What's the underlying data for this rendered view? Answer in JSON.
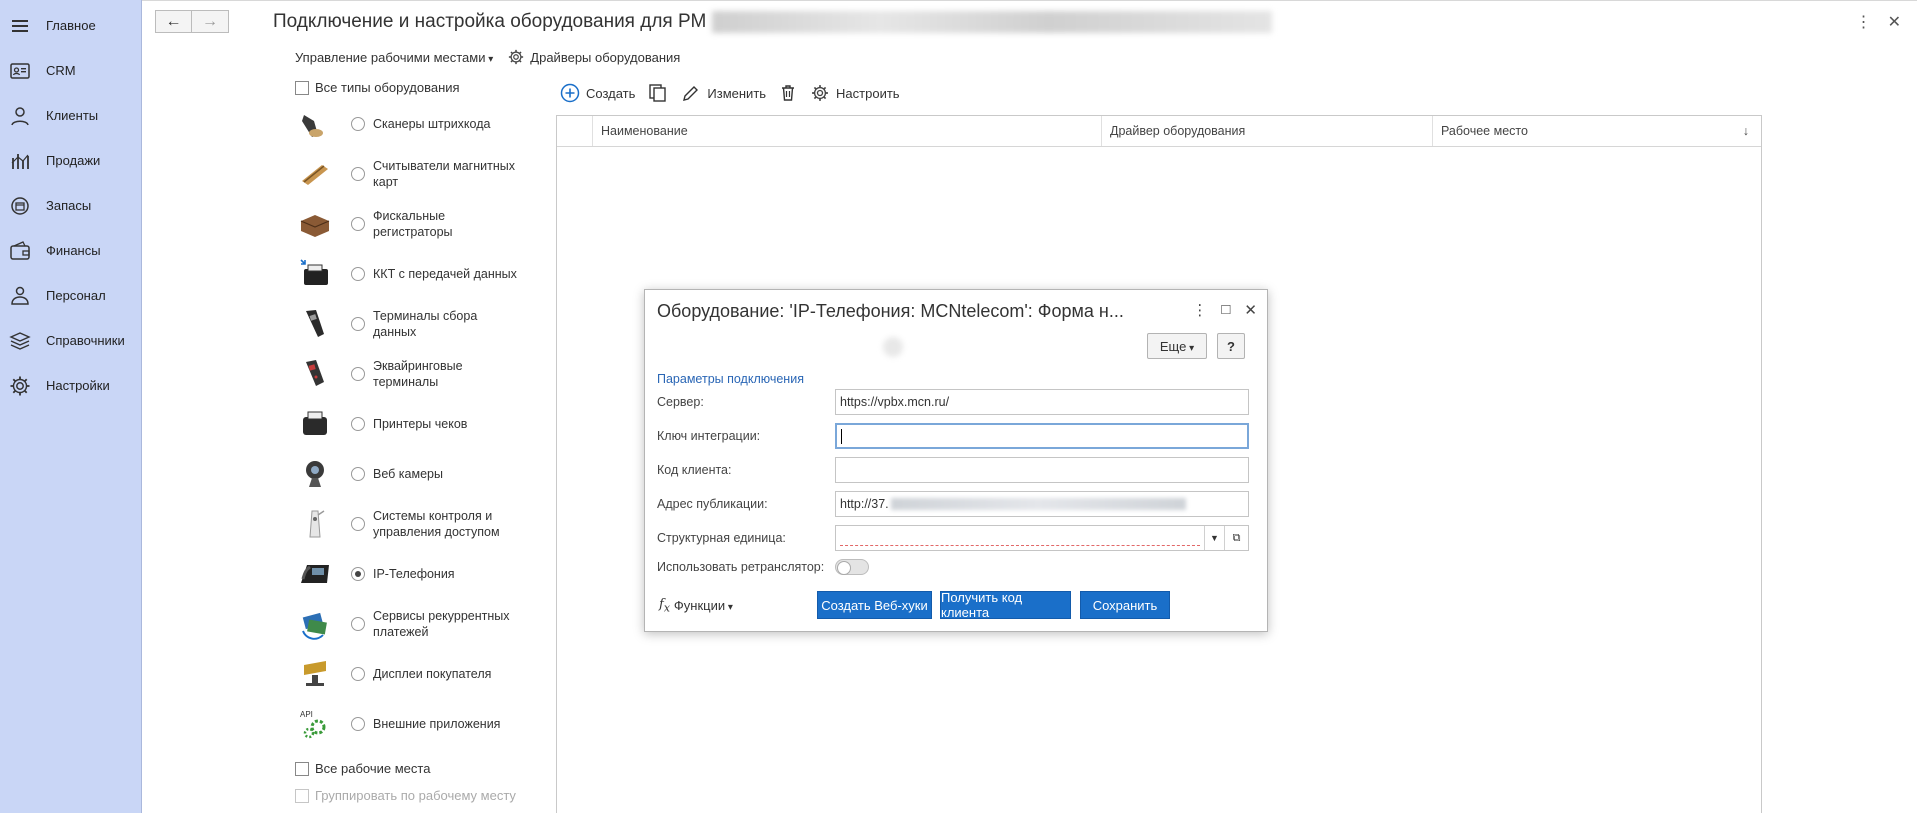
{
  "sidebar": {
    "items": [
      {
        "label": "Главное",
        "icon": "menu-icon"
      },
      {
        "label": "CRM",
        "icon": "contact-card-icon"
      },
      {
        "label": "Клиенты",
        "icon": "person-icon"
      },
      {
        "label": "Продажи",
        "icon": "sales-chart-icon"
      },
      {
        "label": "Запасы",
        "icon": "stock-box-icon"
      },
      {
        "label": "Финансы",
        "icon": "wallet-icon"
      },
      {
        "label": "Персонал",
        "icon": "staff-icon"
      },
      {
        "label": "Справочники",
        "icon": "layers-icon"
      },
      {
        "label": "Настройки",
        "icon": "gear-icon"
      }
    ]
  },
  "header": {
    "title": "Подключение и настройка оборудования для РМ"
  },
  "toolbar": {
    "workplaces_label": "Управление рабочими местами",
    "drivers_label": "Драйверы оборудования"
  },
  "equipment": {
    "all_types_label": "Все типы оборудования",
    "types": [
      {
        "label": "Сканеры штрихкода",
        "icon": "barcode-scanner-icon",
        "selected": false
      },
      {
        "label": "Считыватели магнитных карт",
        "icon": "card-reader-icon",
        "selected": false
      },
      {
        "label": "Фискальные регистраторы",
        "icon": "fiscal-register-icon",
        "selected": false
      },
      {
        "label": "ККТ с передачей данных",
        "icon": "kkt-online-icon",
        "selected": false
      },
      {
        "label": "Терминалы сбора данных",
        "icon": "data-terminal-icon",
        "selected": false
      },
      {
        "label": "Эквайринговые терминалы",
        "icon": "acquiring-terminal-icon",
        "selected": false
      },
      {
        "label": "Принтеры чеков",
        "icon": "receipt-printer-icon",
        "selected": false
      },
      {
        "label": "Веб камеры",
        "icon": "webcam-icon",
        "selected": false
      },
      {
        "label": "Системы контроля и управления доступом",
        "icon": "access-control-icon",
        "selected": false
      },
      {
        "label": "IP-Телефония",
        "icon": "ip-phone-icon",
        "selected": true
      },
      {
        "label": "Сервисы рекуррентных платежей",
        "icon": "recurring-payments-icon",
        "selected": false
      },
      {
        "label": "Дисплеи покупателя",
        "icon": "customer-display-icon",
        "selected": false
      },
      {
        "label": "Внешние приложения",
        "icon": "api-gear-icon",
        "selected": false
      }
    ],
    "all_workplaces_label": "Все рабочие места",
    "group_by_workplace_label": "Группировать по рабочему месту"
  },
  "list_toolbar": {
    "create_label": "Создать",
    "edit_label": "Изменить",
    "configure_label": "Настроить"
  },
  "table": {
    "columns": [
      "Наименование",
      "Драйвер оборудования",
      "Рабочее место"
    ],
    "sort_indicator": "↓",
    "rows": []
  },
  "dialog": {
    "title": "Оборудование: 'IP-Телефония: MCNtelecom': Форма н...",
    "more_label": "Еще",
    "help_label": "?",
    "section_label": "Параметры подключения",
    "fields": {
      "server_label": "Сервер:",
      "server_value": "https://vpbx.mcn.ru/",
      "key_label": "Ключ интеграции:",
      "key_value": "",
      "client_code_label": "Код клиента:",
      "client_code_value": "",
      "publish_label": "Адрес публикации:",
      "publish_value": "http://37.",
      "unit_label": "Структурная единица:",
      "unit_value": "",
      "relay_label": "Использовать ретранслятор:",
      "relay_on": false
    },
    "functions_label": "Функции",
    "buttons": {
      "webhooks": "Создать Веб-хуки",
      "get_code": "Получить код клиента",
      "save": "Сохранить"
    }
  },
  "colors": {
    "sidebar_bg": "#c9d6f6",
    "primary_button": "#1a6fc9",
    "section_link": "#2a66b5"
  }
}
